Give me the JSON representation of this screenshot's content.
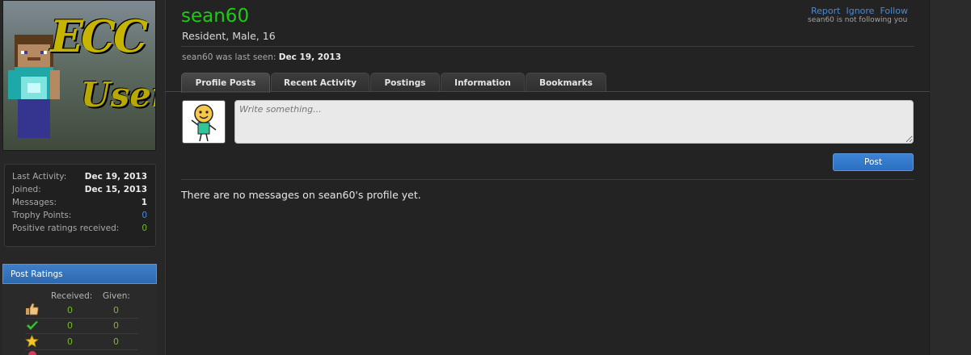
{
  "profile": {
    "username": "sean60",
    "subtitle": "Resident, Male, 16",
    "last_seen_prefix": "sean60 was last seen:",
    "last_seen_date": "Dec 19, 2013",
    "banner_line1": "ECC",
    "banner_line2": "User"
  },
  "actions": {
    "report": "Report",
    "ignore": "Ignore",
    "follow": "Follow",
    "following_note": "sean60 is not following you"
  },
  "stats": [
    {
      "label": "Last Activity:",
      "value": "Dec 19, 2013"
    },
    {
      "label": "Joined:",
      "value": "Dec 15, 2013"
    },
    {
      "label": "Messages:",
      "value": "1"
    },
    {
      "label": "Trophy Points:",
      "value": "0"
    },
    {
      "label": "Positive ratings received:",
      "value": "0"
    }
  ],
  "ratings": {
    "title": "Post Ratings",
    "received_header": "Received:",
    "given_header": "Given:",
    "rows": [
      {
        "icon": "thumbs-up-icon",
        "received": "0",
        "given": "0"
      },
      {
        "icon": "check-icon",
        "received": "0",
        "given": "0"
      },
      {
        "icon": "star-icon",
        "received": "0",
        "given": "0"
      }
    ]
  },
  "tabs": [
    {
      "label": "Profile Posts",
      "active": true
    },
    {
      "label": "Recent Activity",
      "active": false
    },
    {
      "label": "Postings",
      "active": false
    },
    {
      "label": "Information",
      "active": false
    },
    {
      "label": "Bookmarks",
      "active": false
    }
  ],
  "composer": {
    "placeholder": "Write something...",
    "post_label": "Post"
  },
  "empty_message": "There are no messages on sean60's profile yet.",
  "colors": {
    "username": "#1ccc14",
    "link": "#4a8ad6",
    "positive": "#76b82a",
    "accent": "#2d69b1"
  }
}
